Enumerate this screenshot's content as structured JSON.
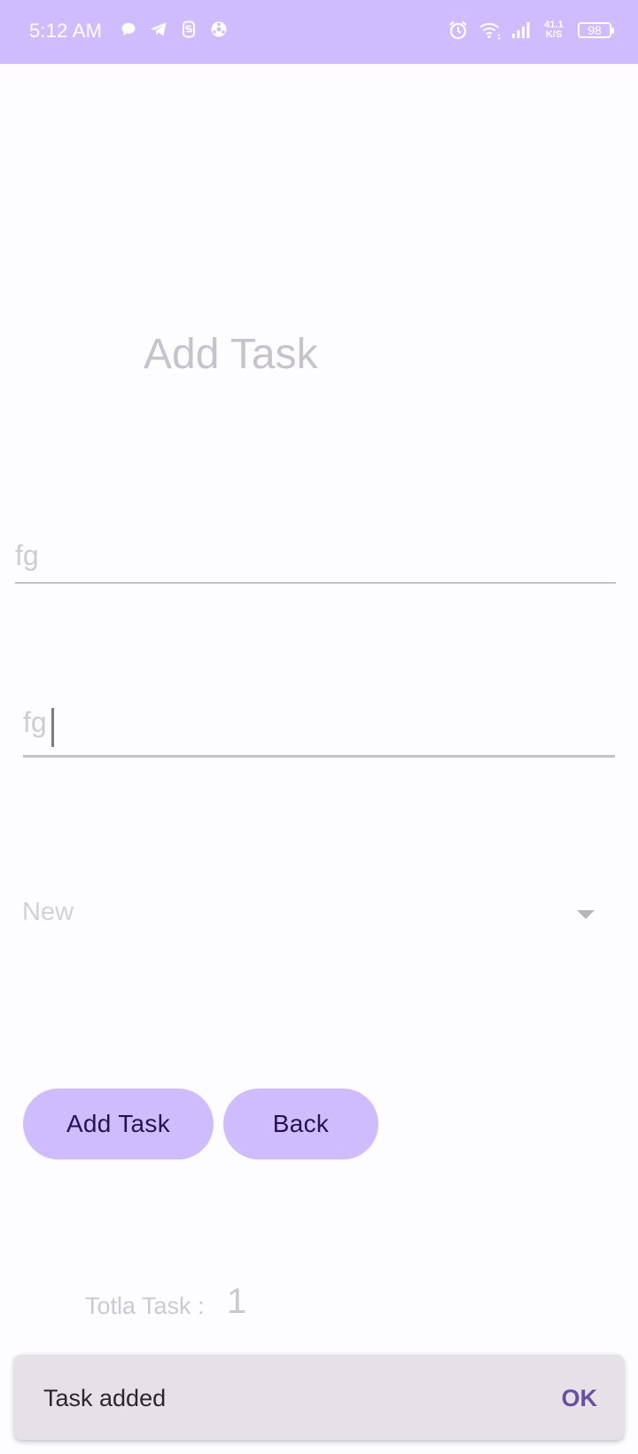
{
  "status_bar": {
    "time": "5:12 AM",
    "net_speed_value": "41.1",
    "net_speed_unit": "K/S",
    "battery": "98",
    "left_icons": [
      "chat-icon",
      "telegram-icon",
      "sync-icon",
      "vpn-icon"
    ],
    "right_icons": [
      "alarm-icon",
      "wifi-icon",
      "signal-icon",
      "battery-icon"
    ]
  },
  "main": {
    "title": "Add Task",
    "field1_value": "fg",
    "field2_value": "fg",
    "status_dropdown": {
      "selected": "New",
      "icon": "caret-down-icon"
    },
    "buttons": {
      "add_label": "Add Task",
      "back_label": "Back"
    },
    "total_label": "Totla Task :",
    "total_value": "1"
  },
  "snackbar": {
    "message": "Task added",
    "action": "OK"
  },
  "colors": {
    "primary_container": "#cfbcff",
    "on_primary_container": "#231454",
    "snackbar_bg": "#e5e1e6",
    "snackbar_action": "#6750a4"
  }
}
